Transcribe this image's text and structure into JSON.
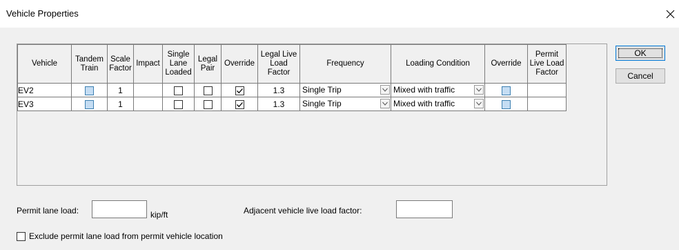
{
  "window": {
    "title": "Vehicle Properties",
    "close_icon": "close-icon"
  },
  "grid": {
    "headers": {
      "vehicle": "Vehicle",
      "tandem_train": "Tandem Train",
      "scale_factor": "Scale Factor",
      "impact": "Impact",
      "single_lane_loaded": "Single Lane Loaded",
      "legal_pair": "Legal Pair",
      "override1": "Override",
      "legal_live_load_factor": "Legal Live Load Factor",
      "frequency": "Frequency",
      "loading_condition": "Loading Condition",
      "override2": "Override",
      "permit_live_load_factor": "Permit Live Load Factor"
    },
    "rows": [
      {
        "vehicle": "EV2",
        "tandem_train": false,
        "scale_factor": "1",
        "impact": "",
        "single_lane_loaded": false,
        "legal_pair": false,
        "override": true,
        "legal_live_load_factor": "1.3",
        "frequency": "Single Trip",
        "loading_condition": "Mixed with traffic",
        "override2": false,
        "permit_live_load_factor": ""
      },
      {
        "vehicle": "EV3",
        "tandem_train": false,
        "scale_factor": "1",
        "impact": "",
        "single_lane_loaded": false,
        "legal_pair": false,
        "override": true,
        "legal_live_load_factor": "1.3",
        "frequency": "Single Trip",
        "loading_condition": "Mixed with traffic",
        "override2": false,
        "permit_live_load_factor": ""
      }
    ]
  },
  "buttons": {
    "ok": "OK",
    "cancel": "Cancel"
  },
  "form": {
    "permit_lane_load_label": "Permit lane load:",
    "permit_lane_load_value": "",
    "permit_lane_load_unit": "kip/ft",
    "adjacent_factor_label": "Adjacent vehicle live load factor:",
    "adjacent_factor_value": "",
    "exclude_label": "Exclude permit lane load from permit vehicle location",
    "exclude_checked": false
  }
}
